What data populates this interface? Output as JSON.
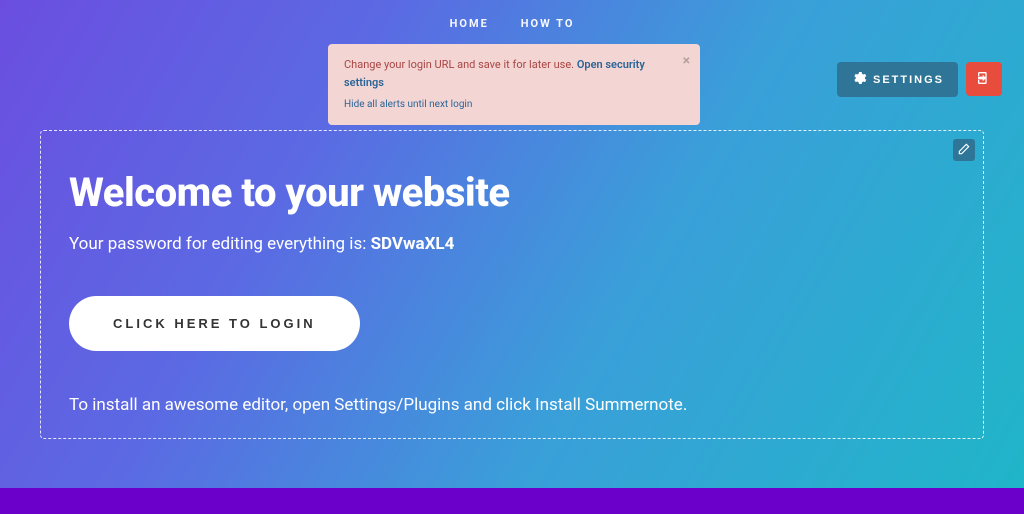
{
  "nav": {
    "home": "HOME",
    "howto": "HOW TO"
  },
  "alert": {
    "text": "Change your login URL and save it for later use.",
    "link": "Open security settings",
    "hide": "Hide all alerts until next login",
    "close": "×"
  },
  "topbar": {
    "settings_label": "SETTINGS"
  },
  "panel": {
    "heading": "Welcome to your website",
    "password_prefix": "Your password for editing everything is: ",
    "password": "SDVwaXL4",
    "login_button": "CLICK HERE TO LOGIN",
    "tip": "To install an awesome editor, open Settings/Plugins and click Install Summernote."
  }
}
